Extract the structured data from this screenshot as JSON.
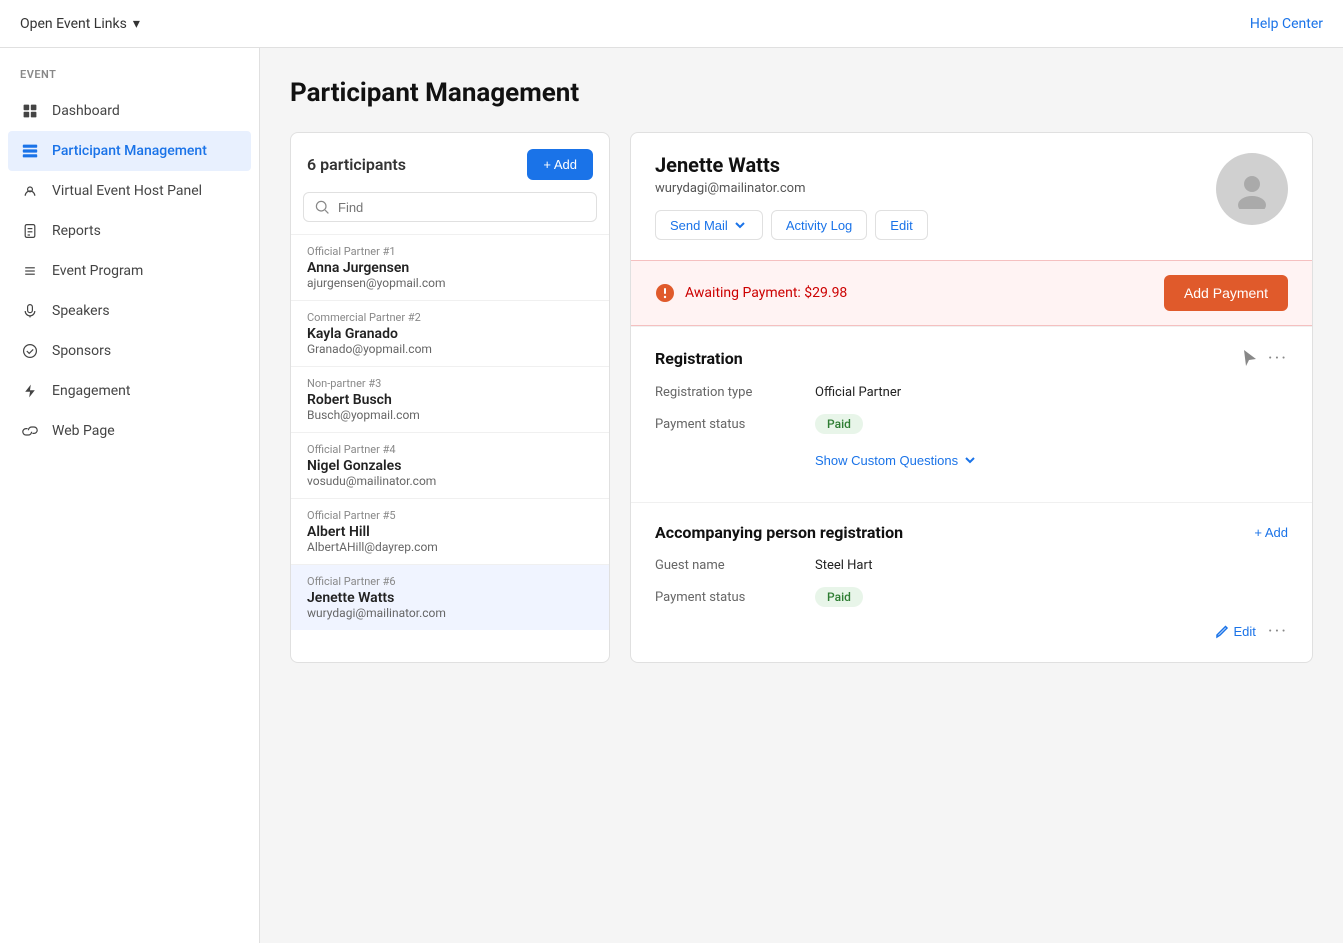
{
  "topbar": {
    "left_label": "Open Event Links",
    "chevron": "▾",
    "right_label": "Help Center"
  },
  "sidebar": {
    "section_label": "EVENT",
    "items": [
      {
        "id": "dashboard",
        "label": "Dashboard",
        "icon": "grid"
      },
      {
        "id": "participant-management",
        "label": "Participant Management",
        "icon": "people",
        "active": true
      },
      {
        "id": "virtual-event-host-panel",
        "label": "Virtual Event Host Panel",
        "icon": "monitor"
      },
      {
        "id": "reports",
        "label": "Reports",
        "icon": "document"
      },
      {
        "id": "event-program",
        "label": "Event Program",
        "icon": "list"
      },
      {
        "id": "speakers",
        "label": "Speakers",
        "icon": "mic"
      },
      {
        "id": "sponsors",
        "label": "Sponsors",
        "icon": "check-circle"
      },
      {
        "id": "engagement",
        "label": "Engagement",
        "icon": "bolt"
      },
      {
        "id": "web-page",
        "label": "Web Page",
        "icon": "link"
      }
    ]
  },
  "page": {
    "title": "Participant Management"
  },
  "participants_panel": {
    "count_label": "6 participants",
    "add_btn_label": "+ Add",
    "search_placeholder": "Find",
    "participants": [
      {
        "tag": "Official Partner  #1",
        "name": "Anna Jurgensen",
        "email": "ajurgensen@yopmail.com",
        "selected": false
      },
      {
        "tag": "Commercial Partner  #2",
        "name": "Kayla Granado",
        "email": "Granado@yopmail.com",
        "selected": false
      },
      {
        "tag": "Non-partner  #3",
        "name": "Robert Busch",
        "email": "Busch@yopmail.com",
        "selected": false
      },
      {
        "tag": "Official Partner  #4",
        "name": "Nigel Gonzales",
        "email": "vosudu@mailinator.com",
        "selected": false
      },
      {
        "tag": "Official Partner  #5",
        "name": "Albert Hill",
        "email": "AlbertAHill@dayrep.com",
        "selected": false
      },
      {
        "tag": "Official Partner  #6",
        "name": "Jenette Watts",
        "email": "wurydagi@mailinator.com",
        "selected": true
      }
    ]
  },
  "detail": {
    "name": "Jenette Watts",
    "email": "wurydagi@mailinator.com",
    "actions": {
      "send_mail": "Send Mail",
      "activity_log": "Activity Log",
      "edit": "Edit"
    },
    "warning": {
      "text": "Awaiting Payment: $29.98",
      "btn_label": "Add Payment"
    },
    "registration": {
      "title": "Registration",
      "type_label": "Registration type",
      "type_value": "Official Partner",
      "payment_label": "Payment status",
      "payment_value": "Paid",
      "show_custom_label": "Show Custom Questions"
    },
    "accompanying": {
      "title": "Accompanying person registration",
      "add_label": "+ Add",
      "guest_name_label": "Guest name",
      "guest_name_value": "Steel Hart",
      "payment_label": "Payment status",
      "payment_value": "Paid",
      "edit_label": "Edit"
    }
  }
}
